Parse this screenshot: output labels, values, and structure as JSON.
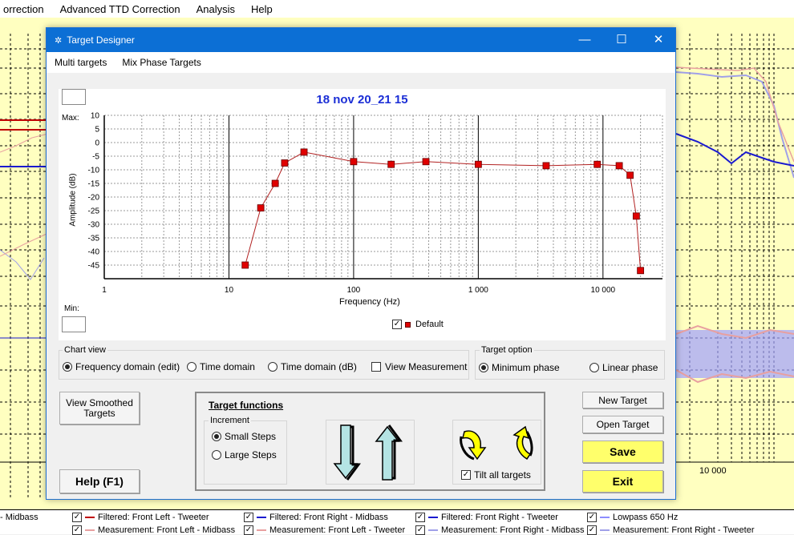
{
  "app": {
    "menu": [
      "orrection",
      "Advanced TTD Correction",
      "Analysis",
      "Help"
    ],
    "bg_xtick": "10 000",
    "legend": [
      {
        "label": "- Midbass",
        "checked": false,
        "color": ""
      },
      {
        "label": "Filtered: Front Left - Tweeter",
        "checked": true,
        "color": "#c00000"
      },
      {
        "label": "Filtered: Front Right - Midbass",
        "checked": true,
        "color": "#1a1acf"
      },
      {
        "label": "Filtered: Front Right - Tweeter",
        "checked": true,
        "color": "#1a1acf"
      },
      {
        "label": "Lowpass  650 Hz",
        "checked": true,
        "color": "#8c8cff"
      },
      {
        "label": "Measurement: Front Left - Midbass",
        "checked": true,
        "color": "#e8a0a0"
      },
      {
        "label": "Measurement: Front Left - Tweeter",
        "checked": true,
        "color": "#e8a0a0"
      },
      {
        "label": "Measurement: Front Right - Midbass",
        "checked": true,
        "color": "#a0a0e8"
      },
      {
        "label": "Measurement: Front Right - Tweeter",
        "checked": true,
        "color": "#a0a0e8"
      }
    ]
  },
  "dialog": {
    "title": "Target Designer",
    "menu": [
      "Multi targets",
      "Mix Phase Targets"
    ],
    "chart_view": {
      "label": "Chart view",
      "options": [
        "Frequency domain (edit)",
        "Time domain",
        "Time domain (dB)"
      ],
      "selected": "Frequency domain (edit)",
      "view_measurement": "View Measurement"
    },
    "target_option": {
      "label": "Target option",
      "options": [
        "Minimum phase",
        "Linear phase"
      ],
      "selected": "Minimum phase"
    },
    "buttons": {
      "view_smoothed": "View Smoothed Targets",
      "help": "Help (F1)",
      "new_target": "New Target",
      "open_target": "Open Target",
      "save": "Save",
      "exit": "Exit"
    },
    "target_functions": {
      "title": "Target functions",
      "increment_label": "Increment",
      "increment_options": [
        "Small Steps",
        "Large Steps"
      ],
      "increment_selected": "Small Steps",
      "tilt_label": "Tilt all targets"
    }
  },
  "chart_data": {
    "type": "line",
    "title": "18 nov 20_21 15",
    "xlabel": "Frequency (Hz)",
    "ylabel": "Amplitude (dB)",
    "max_label": "Max:",
    "min_label": "Min:",
    "xscale": "log",
    "xlim": [
      1,
      30000
    ],
    "ylim": [
      -50,
      10
    ],
    "x_ticks": [
      "1",
      "10",
      "100",
      "1 000",
      "10 000"
    ],
    "y_ticks": [
      "10",
      "5",
      "0",
      "-5",
      "-10",
      "-15",
      "-20",
      "-25",
      "-30",
      "-35",
      "-40",
      "-45"
    ],
    "grid": true,
    "series": [
      {
        "name": "Default",
        "color": "#b22222",
        "marker_color": "#e00000",
        "x": [
          13.5,
          18,
          23.5,
          28,
          40,
          100,
          200,
          380,
          1000,
          3500,
          9000,
          13500,
          16500,
          18500,
          20000
        ],
        "y": [
          -45,
          -24,
          -15,
          -7.5,
          -3.5,
          -7,
          -8,
          -7,
          -8,
          -8.5,
          -8,
          -8.5,
          -12,
          -27,
          -47
        ]
      }
    ],
    "legend_checked": true
  }
}
